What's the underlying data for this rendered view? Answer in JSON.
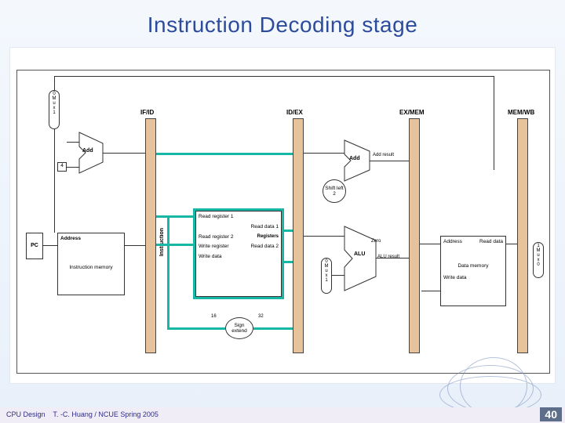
{
  "slide": {
    "title": "Instruction Decoding stage",
    "footer_left": "CPU Design",
    "footer_mid": "T. -C. Huang / NCUE   Spring 2005",
    "page_number": "40"
  },
  "pipeline_registers": {
    "ifid": "IF/ID",
    "idex": "ID/EX",
    "exmem": "EX/MEM",
    "memwb": "MEM/WB"
  },
  "blocks": {
    "pc": "PC",
    "instr_mem_title": "Address",
    "instr_mem_name": "Instruction memory",
    "add_if": "Add",
    "constant4": "4",
    "mux0": {
      "top": "0",
      "mid": "M\nu\nx",
      "bot": "1"
    },
    "registers_title": "Registers",
    "read_reg1": "Read register 1",
    "read_reg2": "Read register 2",
    "write_reg": "Write register",
    "write_data_reg": "Write data",
    "read_data1": "Read data 1",
    "read_data2": "Read data 2",
    "sign_extend": "Sign extend",
    "sign_in": "16",
    "sign_out": "32",
    "instruction_lbl": "Instruction",
    "shift_left2": "Shift left 2",
    "add_ex": "Add",
    "add_result": "Add result",
    "alu": "ALU",
    "alu_result": "ALU result",
    "zero": "Zero",
    "mux1": {
      "top": "0",
      "mid": "M\nu\nx",
      "bot": "1"
    },
    "data_mem_addr": "Address",
    "data_mem_name": "Data memory",
    "data_mem_read": "Read data",
    "data_mem_write": "Write data",
    "mux2": {
      "top": "1",
      "mid": "M\nu\nx",
      "bot": "0"
    }
  },
  "colors": {
    "highlight": "#16b7a4",
    "pipeline_reg": "#e6c39b",
    "title": "#2c4b9c"
  }
}
